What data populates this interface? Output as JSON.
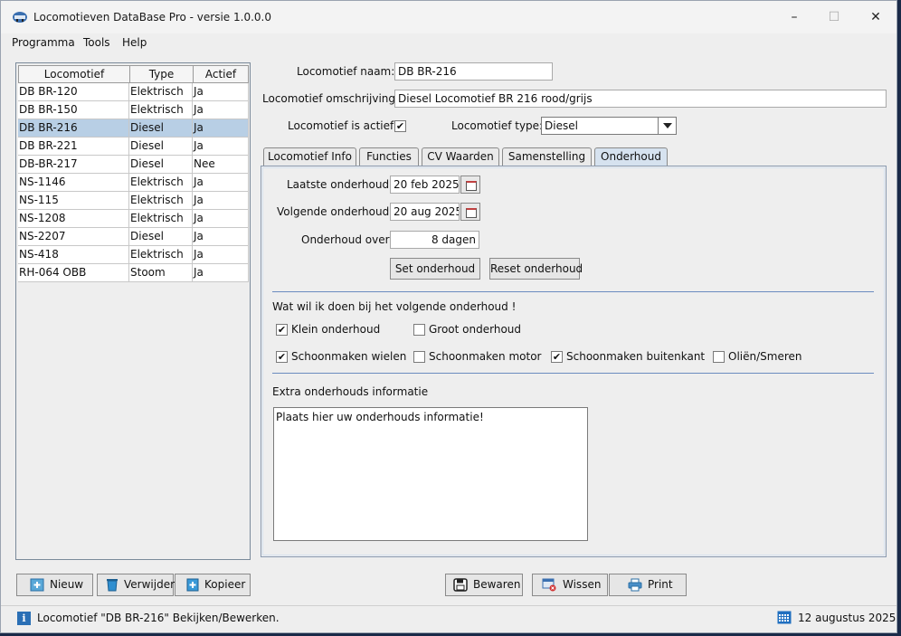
{
  "window": {
    "title": "Locomotieven DataBase Pro - versie 1.0.0.0",
    "minimize": "–",
    "maximize": "☐",
    "close": "✕"
  },
  "menu": [
    "Programma",
    "Tools",
    "Help"
  ],
  "table": {
    "headers": [
      "Locomotief",
      "Type",
      "Actief"
    ],
    "rows": [
      [
        "DB BR-120",
        "Elektrisch",
        "Ja"
      ],
      [
        "DB BR-150",
        "Elektrisch",
        "Ja"
      ],
      [
        "DB BR-216",
        "Diesel",
        "Ja"
      ],
      [
        "DB BR-221",
        "Diesel",
        "Ja"
      ],
      [
        "DB-BR-217",
        "Diesel",
        "Nee"
      ],
      [
        "NS-1146",
        "Elektrisch",
        "Ja"
      ],
      [
        "NS-115",
        "Elektrisch",
        "Ja"
      ],
      [
        "NS-1208",
        "Elektrisch",
        "Ja"
      ],
      [
        "NS-2207",
        "Diesel",
        "Ja"
      ],
      [
        "NS-418",
        "Elektrisch",
        "Ja"
      ],
      [
        "RH-064 OBB",
        "Stoom",
        "Ja"
      ]
    ],
    "selected_index": 2
  },
  "form": {
    "name_label": "Locomotief naam:",
    "name_value": "DB BR-216",
    "desc_label": "Locomotief omschrijving:",
    "desc_value": "Diesel Locomotief BR 216 rood/grijs",
    "active_label": "Locomotief is actief:",
    "active_checked": "✔",
    "type_label": "Locomotief type:",
    "type_value": "Diesel"
  },
  "tabs": [
    "Locomotief Info",
    "Functies",
    "CV Waarden",
    "Samenstelling",
    "Onderhoud"
  ],
  "active_tab": "Onderhoud",
  "onderhoud": {
    "last_label": "Laatste onderhoud",
    "last_value": "20 feb 2025",
    "next_label": "Volgende onderhoud",
    "next_value": "20 aug 2025",
    "over_label": "Onderhoud over",
    "over_value": "8 dagen",
    "set_button": "Set onderhoud",
    "reset_button": "Reset onderhoud",
    "question": "Wat wil ik doen bij het volgende onderhoud !",
    "klein": "Klein onderhoud",
    "groot": "Groot onderhoud",
    "wielen": "Schoonmaken wielen",
    "motor": "Schoonmaken motor",
    "buitenkant": "Schoonmaken buitenkant",
    "olien": "Oliën/Smeren",
    "check_mark": "✔",
    "extra_label": "Extra onderhouds informatie",
    "extra_text": "Plaats hier uw onderhouds informatie!"
  },
  "buttons": {
    "nieuw": "Nieuw",
    "verwijder": "Verwijder",
    "kopieer": "Kopieer",
    "bewaren": "Bewaren",
    "wissen": "Wissen",
    "print": "Print"
  },
  "status": {
    "message": "Locomotief \"DB BR-216\" Bekijken/Bewerken.",
    "date": "12 augustus 2025",
    "info_glyph": "i"
  },
  "icons": [
    "app-icon",
    "info-icon",
    "calendar-icon",
    "trash-icon",
    "add-icon",
    "copy-icon",
    "save-icon",
    "erase-icon",
    "printer-icon"
  ]
}
